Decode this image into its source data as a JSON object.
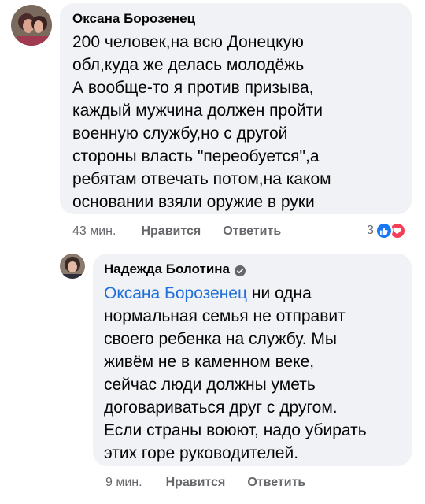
{
  "comments": [
    {
      "author": "Оксана Борозенец",
      "text": "200 человек,на всю Донецкую\nобл,куда же делась молодёжь\nА вообще-то я против призыва,\nкаждый мужчина должен пройти\nвоенную службу,но с  другой\nстороны власть \"переобуется\",а\nребятам отвечать потом,на каком\nосновании взяли оружие в руки",
      "time": "43 мин.",
      "like_label": "Нравится",
      "reply_label": "Ответить",
      "reaction_count": "3",
      "reactions": [
        "like",
        "love"
      ]
    },
    {
      "author": "Надежда Болотина",
      "verified": true,
      "mention": "Оксана Борозенец",
      "text": " ни одна\nнормальная семья не отправит\nсвоего ребенка на службу. Мы\nживём не в каменном веке,\nсейчас люди должны уметь\nдоговариваться друг с другом.\nЕсли страны воюют, надо убирать\nэтих горе руководителей.",
      "time": "9 мин.",
      "like_label": "Нравится",
      "reply_label": "Ответить"
    }
  ],
  "colors": {
    "bubble": "#f0f2f5",
    "mention": "#216fdb",
    "meta": "#65676b",
    "like": "#1877f2",
    "love": "#f33e58"
  }
}
